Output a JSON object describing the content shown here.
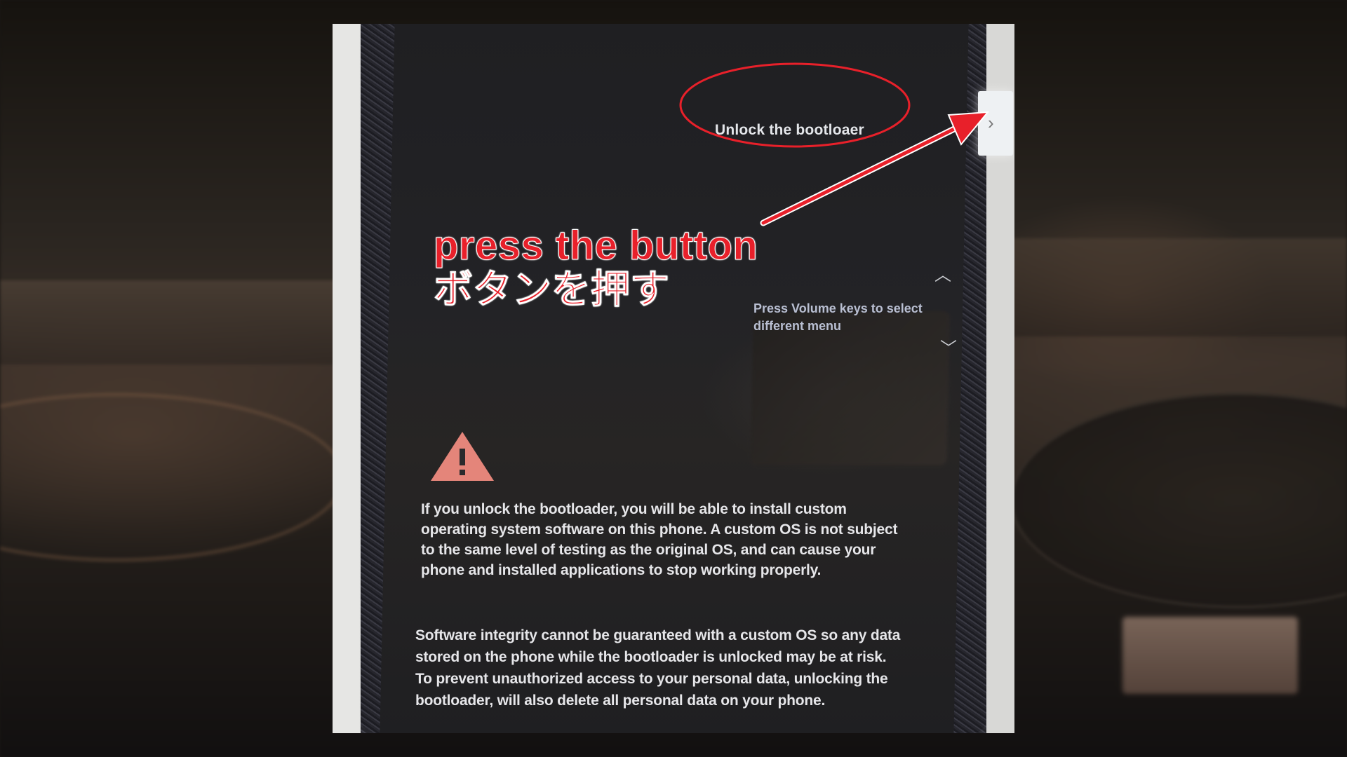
{
  "screen": {
    "unlock_option": "Unlock the bootloaer",
    "volume_hint": "Press Volume keys to select different menu",
    "warning_text_1": [
      "If you unlock the bootloader, you will be able to install custom",
      "operating system software on this phone. A custom OS is not subject",
      "to the same level of testing as the original OS, and can cause your",
      "phone and installed applications to stop working properly."
    ],
    "warning_text_2": [
      "Software integrity cannot be guaranteed with a custom OS so any data",
      "stored on the phone while the bootloader is unlocked may be at risk.",
      "To prevent unauthorized access to your personal data, unlocking the",
      "bootloader, will also delete all personal data on your phone."
    ]
  },
  "annotation": {
    "english": "press the button",
    "japanese": "ボタンを押す",
    "color": "#e8202a"
  },
  "icons": {
    "warning": "warning-triangle-icon",
    "next": "chevron-right-icon",
    "up": "chevron-up-icon",
    "down": "chevron-down-icon"
  }
}
